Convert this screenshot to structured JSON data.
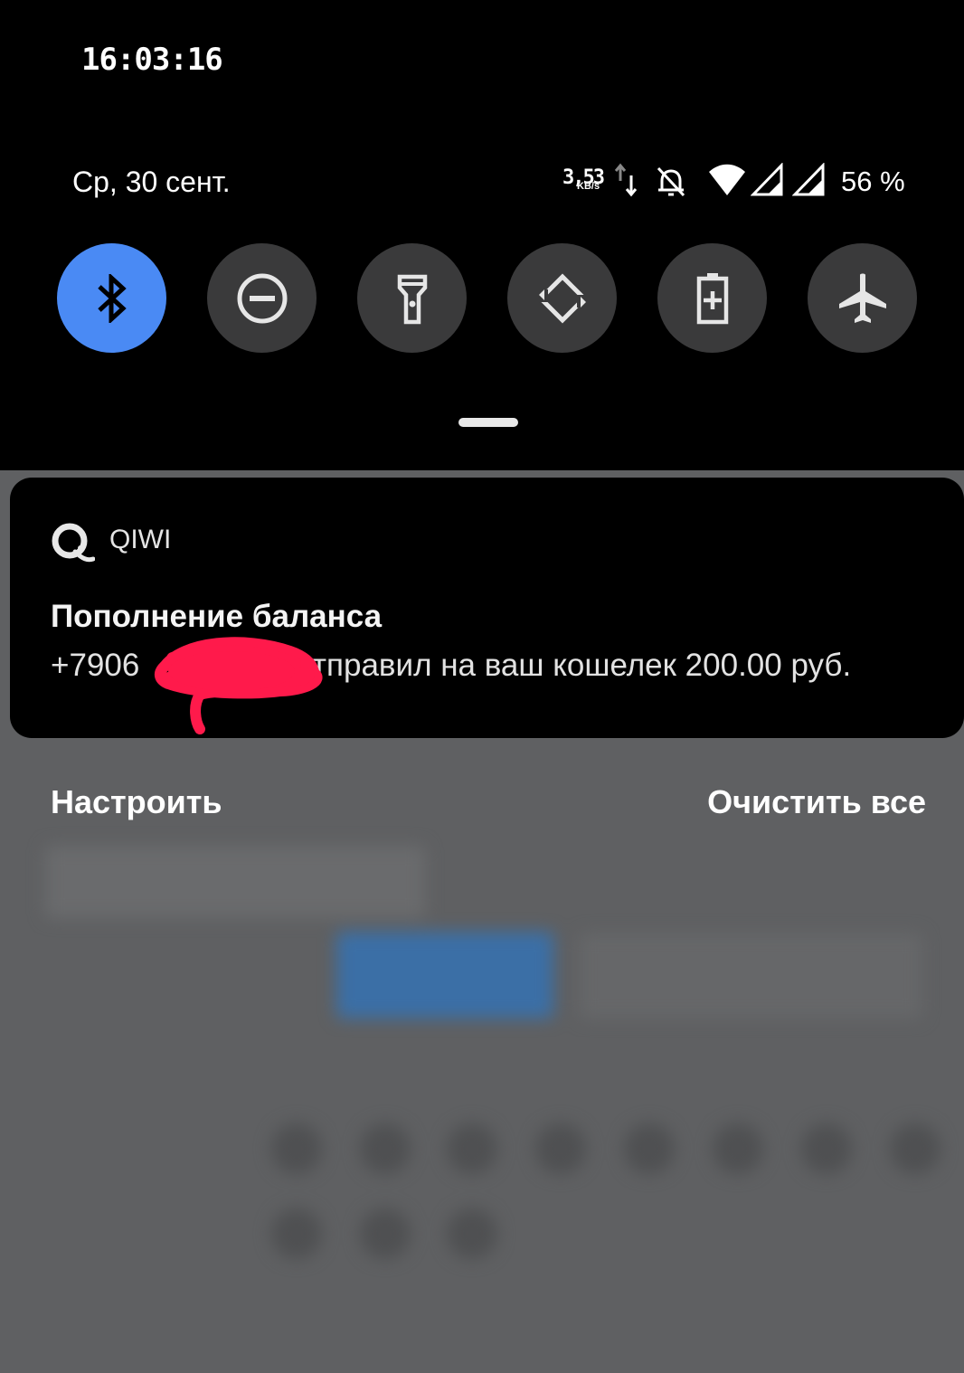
{
  "status_bar": {
    "clock": "16:03:16",
    "date": "Ср, 30 сент.",
    "net_speed": "3,53",
    "net_speed_unit": "KB/s",
    "battery": "56 %"
  },
  "quick_settings": {
    "tiles": [
      {
        "name": "bluetooth",
        "icon": "bluetooth-icon",
        "active": true
      },
      {
        "name": "do-not-disturb",
        "icon": "minus-circle-icon",
        "active": false
      },
      {
        "name": "flashlight",
        "icon": "flashlight-icon",
        "active": false
      },
      {
        "name": "auto-rotate",
        "icon": "rotate-icon",
        "active": false
      },
      {
        "name": "battery-saver",
        "icon": "battery-plus-icon",
        "active": false
      },
      {
        "name": "airplane-mode",
        "icon": "airplane-icon",
        "active": false
      }
    ]
  },
  "notification": {
    "app_name": "QIWI",
    "title": "Пополнение баланса",
    "body_prefix": "+7906",
    "body_suffix": "отправил на ваш кошелек 200.00 руб."
  },
  "actions": {
    "manage": "Настроить",
    "clear_all": "Очистить все"
  },
  "colors": {
    "accent": "#4a8af4",
    "tile_bg": "#3a3a3b",
    "scribble": "#ff1a4b"
  }
}
